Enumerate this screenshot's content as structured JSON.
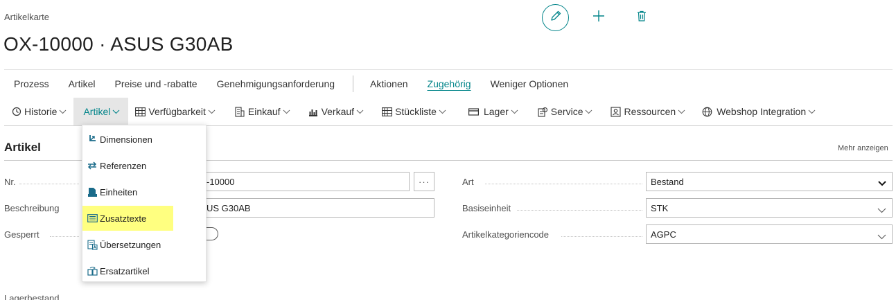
{
  "header": {
    "caption": "Artikelkarte",
    "title": "OX-10000 · ASUS G30AB"
  },
  "icons": {
    "edit": "pencil-icon",
    "new": "plus-icon",
    "delete": "trash-icon"
  },
  "action_bar": {
    "items": [
      "Prozess",
      "Artikel",
      "Preise und -rabatte",
      "Genehmigungsanforderung"
    ],
    "items_right": [
      "Aktionen",
      "Zugehörig",
      "Weniger Optionen"
    ],
    "active": "Zugehörig"
  },
  "sub_bar": {
    "items": [
      "Historie",
      "Artikel",
      "Verfügbarkeit",
      "Einkauf",
      "Verkauf",
      "Stückliste",
      "Lager",
      "Service",
      "Ressourcen",
      "Webshop Integration"
    ],
    "selected": "Artikel"
  },
  "section": {
    "title": "Artikel",
    "more": "Mehr anzeigen"
  },
  "fields": {
    "nr": {
      "label": "Nr.",
      "value": "-10000"
    },
    "beschreibung": {
      "label": "Beschreibung",
      "value": "US G30AB"
    },
    "gesperrt": {
      "label": "Gesperrt"
    },
    "art": {
      "label": "Art",
      "value": "Bestand"
    },
    "basiseinheit": {
      "label": "Basiseinheit",
      "value": "STK"
    },
    "kategorie": {
      "label": "Artikelkategoriencode",
      "value": "AGPC"
    },
    "nr_assist": "···"
  },
  "dropdown": {
    "items": [
      "Dimensionen",
      "Referenzen",
      "Einheiten",
      "Zusatztexte",
      "Übersetzungen",
      "Ersatzartikel"
    ],
    "highlighted": "Zusatztexte"
  },
  "colors": {
    "accent": "#008489",
    "highlight": "#ffff80",
    "selected_bg": "#e6e6e6"
  },
  "partial_text": "Lagerbestand"
}
